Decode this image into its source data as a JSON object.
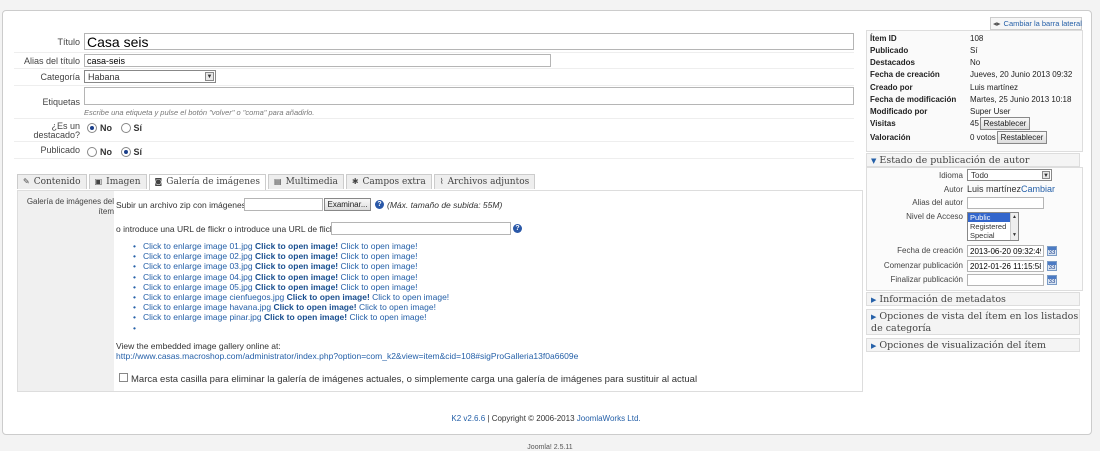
{
  "form": {
    "titulo_label": "Título",
    "titulo_value": "Casa seis",
    "alias_label": "Alias del título",
    "alias_value": "casa-seis",
    "categoria_label": "Categoría",
    "categoria_value": "Habana",
    "etiquetas_label": "Etiquetas",
    "etiquetas_value": "",
    "etiquetas_hint": "Escribe una etiqueta y pulse el botón \"volver\" o \"coma\" para añadirlo.",
    "destacado_label_1": "¿Es un",
    "destacado_label_2": "destacado?",
    "publicado_label": "Publicado",
    "opt_no": "No",
    "opt_si": "Sí",
    "destacado_value": "No",
    "publicado_value": "Sí"
  },
  "tabs": [
    {
      "label": "Contenido",
      "icon": "pencil-icon",
      "glyph": "✎"
    },
    {
      "label": "Imagen",
      "icon": "image-icon",
      "glyph": "▣"
    },
    {
      "label": "Galería de imágenes",
      "icon": "camera-icon",
      "glyph": "◙",
      "active": true
    },
    {
      "label": "Multimedia",
      "icon": "film-icon",
      "glyph": "▤"
    },
    {
      "label": "Campos extra",
      "icon": "tools-icon",
      "glyph": "✱"
    },
    {
      "label": "Archivos adjuntos",
      "icon": "paperclip-icon",
      "glyph": "⌇"
    }
  ],
  "gallery": {
    "side_label_1": "Galería de imágenes del",
    "side_label_2": "ítem",
    "upload_label": "Subir un archivo zip con imágenes",
    "browse_button": "Examinar...",
    "max_size_note": "(Máx. tamaño de subida: 55M)",
    "flickr_label": "o introduce una URL de flickr o introduce una URL de flickr",
    "flickr_value": "",
    "images": [
      {
        "a": "Click to enlarge image 01.jpg",
        "b": "Click to open image!",
        "c": "Click to open image!"
      },
      {
        "a": "Click to enlarge image 02.jpg",
        "b": "Click to open image!",
        "c": "Click to open image!"
      },
      {
        "a": "Click to enlarge image 03.jpg",
        "b": "Click to open image!",
        "c": "Click to open image!"
      },
      {
        "a": "Click to enlarge image 04.jpg",
        "b": "Click to open image!",
        "c": "Click to open image!"
      },
      {
        "a": "Click to enlarge image 05.jpg",
        "b": "Click to open image!",
        "c": "Click to open image!"
      },
      {
        "a": "Click to enlarge image cienfuegos.jpg",
        "b": "Click to open image!",
        "c": "Click to open image!"
      },
      {
        "a": "Click to enlarge image havana.jpg",
        "b": "Click to open image!",
        "c": "Click to open image!"
      },
      {
        "a": "Click to enlarge image pinar.jpg",
        "b": "Click to open image!",
        "c": "Click to open image!"
      },
      {
        "a": "",
        "b": "",
        "c": ""
      }
    ],
    "embed_text": "View the embedded image gallery online at:",
    "embed_url": "http://www.casas.macroshop.com/administrator/index.php?option=com_k2&view=item&cid=108#sigProGalleria13f0a6609e",
    "replace_checkbox_label": "Marca esta casilla para eliminar la galería de imágenes actuales, o simplemente carga una galería de imágenes para sustituir al actual"
  },
  "footer": {
    "version_link": "K2 v2.6.6",
    "copyright": " | Copyright © 2006-2013 ",
    "company_link": "JoomlaWorks Ltd.",
    "joomla": "Joomla! 2.5.11"
  },
  "sidebar": {
    "toggle_label": "Cambiar la barra lateral",
    "info": [
      {
        "key": "Ítem ID",
        "value": "108"
      },
      {
        "key": "Publicado",
        "value": "Sí"
      },
      {
        "key": "Destacados",
        "value": "No"
      },
      {
        "key": "Fecha de creación",
        "value": "Jueves, 20 Junio 2013 09:32"
      },
      {
        "key": "Creado por",
        "value": "Luis martínez"
      },
      {
        "key": "Fecha de modificación",
        "value": "Martes, 25 Junio 2013 10:18"
      },
      {
        "key": "Modificado por",
        "value": "Super User"
      },
      {
        "key": "Visitas",
        "value": "45"
      },
      {
        "key": "Valoración",
        "value": "0 votos"
      }
    ],
    "reset_button": "Restablecer",
    "pub_panel": {
      "header": "Estado de publicación de autor",
      "idioma_label": "Idioma",
      "idioma_value": "Todo",
      "autor_label": "Autor",
      "autor_value": "Luis martínez",
      "autor_change": "Cambiar",
      "alias_autor_label": "Alias del autor",
      "alias_autor_value": "",
      "acceso_label": "Nivel de Acceso",
      "acceso_options": [
        "Public",
        "Registered",
        "Special"
      ],
      "acceso_selected": "Public",
      "fecha_creacion_label": "Fecha de creación",
      "fecha_creacion_value": "2013-06-20 09:32:49",
      "comenzar_label": "Comenzar publicación",
      "comenzar_value": "2012-01-26 11:15:58",
      "finalizar_label": "Finalizar publicación",
      "finalizar_value": "",
      "calendar_glyph": "33"
    },
    "collapsed": [
      "Información de metadatos",
      "Opciones de vista del ítem en los listados de categoría",
      "Opciones de visualización del ítem"
    ]
  },
  "colors": {
    "link": "#2560a8",
    "accent": "#1a4f8f"
  }
}
